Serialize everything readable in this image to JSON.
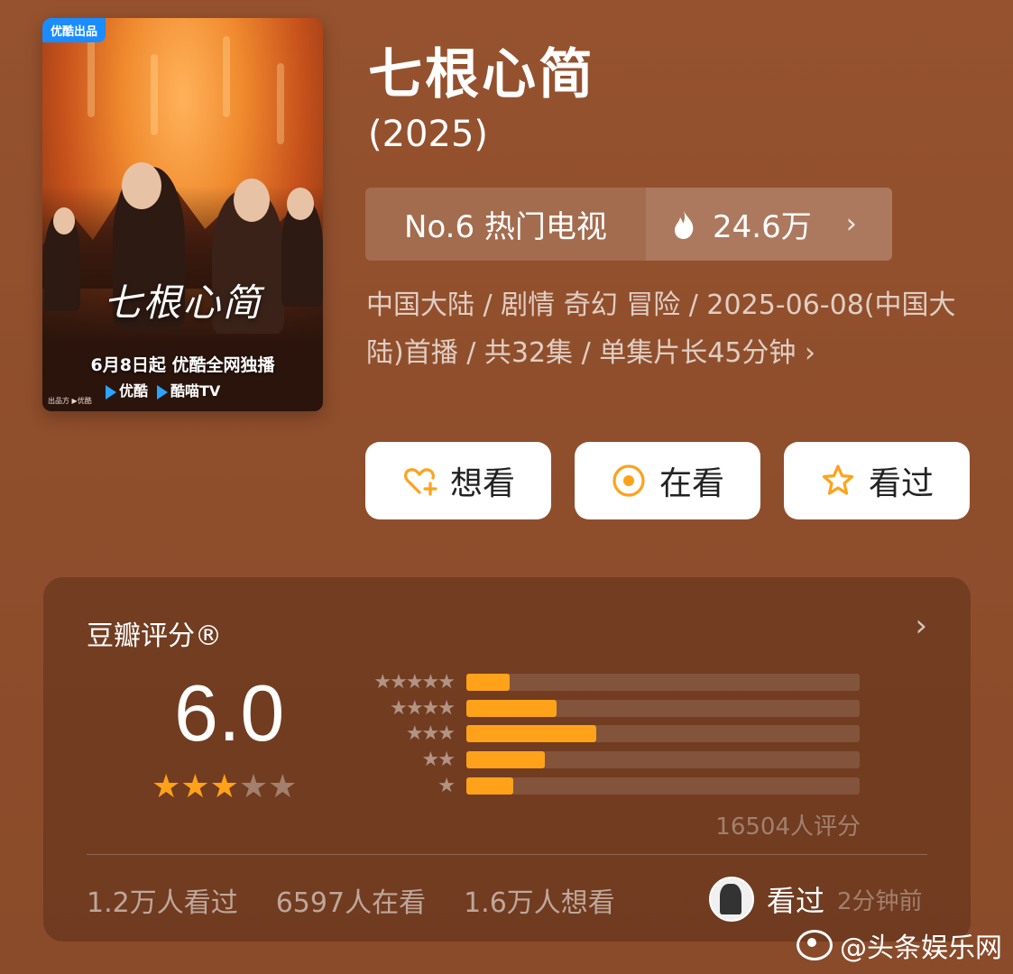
{
  "poster": {
    "badge": "优酷出品",
    "title_art": "七根心简",
    "release_line": "6月8日起 优酷全网独播",
    "platforms": [
      "优酷",
      "酷喵TV"
    ],
    "footer": "出品方 ▶优酷"
  },
  "show": {
    "title": "七根心简",
    "year": "(2025)"
  },
  "rank": {
    "label": "No.6 热门电视",
    "heat": "24.6万",
    "chevron": "›"
  },
  "meta": {
    "text": "中国大陆 / 剧情 奇幻 冒险 / 2025-06-08(中国大陆)首播 / 共32集 / 单集片长45分钟 ›"
  },
  "actions": {
    "want": "想看",
    "watching": "在看",
    "watched": "看过"
  },
  "rating": {
    "title": "豆瓣评分®",
    "chevron": "›",
    "score": "6.0",
    "stars_filled": 3,
    "stars_total": 5,
    "distribution": [
      {
        "stars": "★★★★★",
        "fraction": 0.11
      },
      {
        "stars": "★★★★",
        "fraction": 0.23
      },
      {
        "stars": "★★★",
        "fraction": 0.33
      },
      {
        "stars": "★★",
        "fraction": 0.2
      },
      {
        "stars": "★",
        "fraction": 0.12
      }
    ],
    "count": "16504人评分",
    "watched": "1.2万人看过",
    "watching": "6597人在看",
    "want": "1.6万人想看",
    "recent_status": "看过",
    "recent_time": "2分钟前"
  },
  "watermark": "@头条娱乐网",
  "colors": {
    "accent": "#ffa21a",
    "background": "#8f4e2c"
  }
}
